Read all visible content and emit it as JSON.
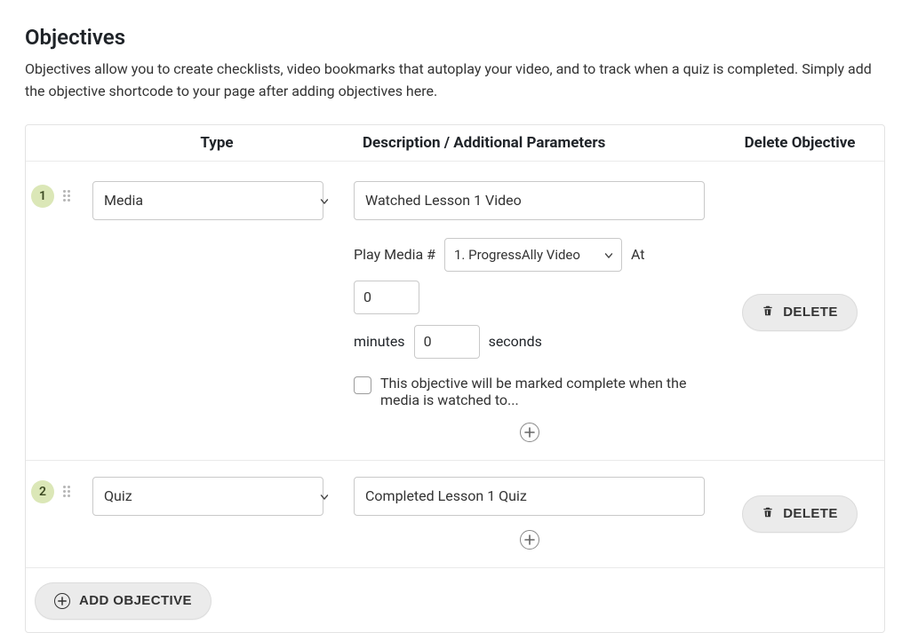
{
  "page": {
    "title": "Objectives",
    "intro": "Objectives allow you to create checklists, video bookmarks that autoplay your video, and to track when a quiz is completed. Simply add the objective shortcode to your page after adding objectives here."
  },
  "headers": {
    "type": "Type",
    "desc": "Description / Additional Parameters",
    "delete": "Delete Objective"
  },
  "labels": {
    "play_media_num": "Play Media #",
    "at": "At",
    "minutes": "minutes",
    "seconds": "seconds",
    "delete_btn": "DELETE",
    "add_btn": "ADD OBJECTIVE"
  },
  "rows": [
    {
      "num": "1",
      "type": "Media",
      "description": "Watched Lesson 1 Video",
      "media_selected": "1. ProgressAlly Video",
      "at_minutes": "0",
      "at_seconds": "0",
      "checkbox_label": "This objective will be marked complete when the media is watched to..."
    },
    {
      "num": "2",
      "type": "Quiz",
      "description": "Completed Lesson 1 Quiz"
    }
  ]
}
